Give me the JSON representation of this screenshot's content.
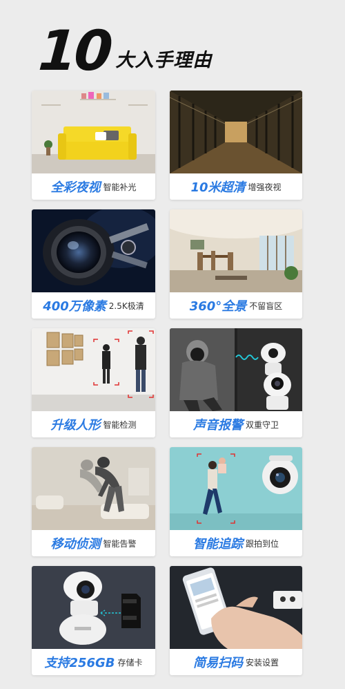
{
  "header": {
    "number": "10",
    "title": "大入手理由"
  },
  "features": [
    {
      "title": "全彩夜视",
      "subtitle": "智能补光",
      "photo": "living-room-yellow-sofa"
    },
    {
      "title": "10米超清",
      "subtitle": "增强夜视",
      "photo": "glass-corridor"
    },
    {
      "title": "400万像素",
      "subtitle": "2.5K极清",
      "photo": "camera-lens"
    },
    {
      "title": "360°全景",
      "subtitle": "不留盲区",
      "photo": "dining-hall"
    },
    {
      "title": "升级人形",
      "subtitle": "智能检测",
      "photo": "gallery-people-detection"
    },
    {
      "title": "声音报警",
      "subtitle": "双重守卫",
      "photo": "hooded-figure-camera"
    },
    {
      "title": "移动侦测",
      "subtitle": "智能告警",
      "photo": "motion-bending-person"
    },
    {
      "title": "智能追踪",
      "subtitle": "跟拍到位",
      "photo": "woman-with-child-tracking"
    },
    {
      "title": "支持256GB",
      "subtitle": "存储卡",
      "photo": "camera-with-sd-card"
    },
    {
      "title": "简易扫码",
      "subtitle": "安装设置",
      "photo": "hand-holding-phone"
    }
  ],
  "colors": {
    "accent": "#2a7ae2",
    "background": "#ececec",
    "card": "#ffffff"
  }
}
